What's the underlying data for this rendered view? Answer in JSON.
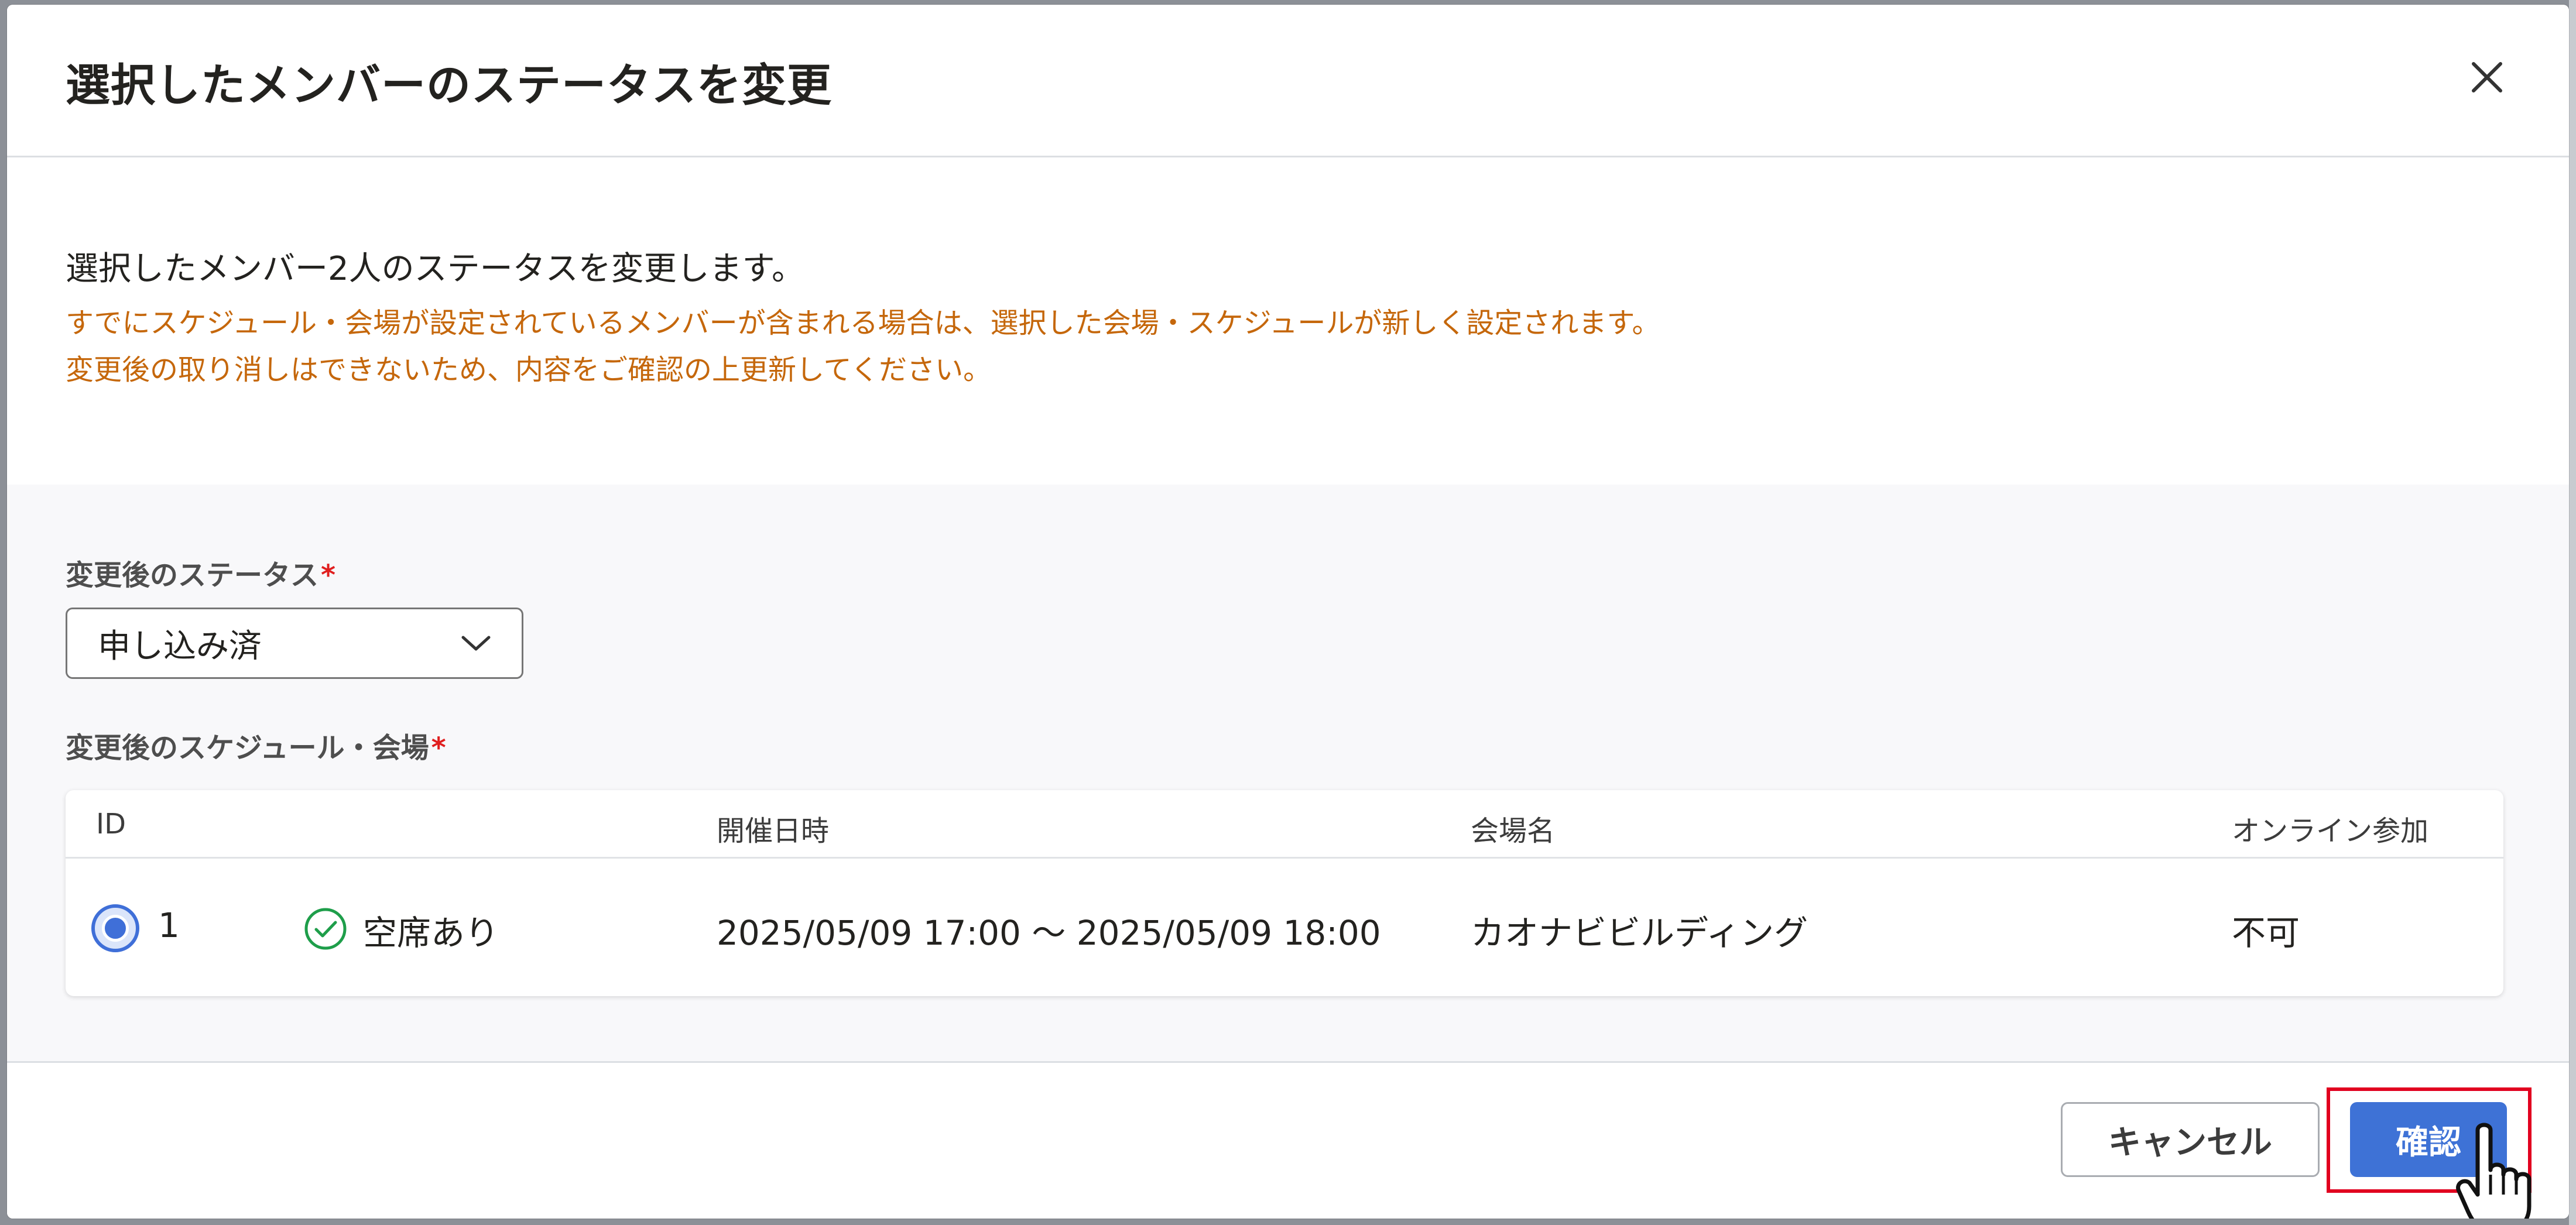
{
  "dialog": {
    "title": "選択したメンバーのステータスを変更",
    "close_label": "×"
  },
  "intro": {
    "main": "選択したメンバー2人のステータスを変更します。",
    "warning_line1": "すでにスケジュール・会場が設定されているメンバーが含まれる場合は、選択した会場・スケジュールが新しく設定されます。",
    "warning_line2": "変更後の取り消しはできないため、内容をご確認の上更新してください。"
  },
  "status_field": {
    "label": "変更後のステータス",
    "required_mark": "*",
    "selected_value": "申し込み済"
  },
  "schedule_field": {
    "label": "変更後のスケジュール・会場",
    "required_mark": "*",
    "columns": [
      "ID",
      "開催日時",
      "会場名",
      "オンライン参加"
    ],
    "rows": [
      {
        "selected": true,
        "id": "1",
        "availability": "空席あり",
        "datetime": "2025/05/09 17:00 〜 2025/05/09 18:00",
        "venue": "カオナビビルディング",
        "online": "不可"
      }
    ]
  },
  "footer": {
    "cancel_label": "キャンセル",
    "confirm_label": "確認"
  },
  "colors": {
    "warning_text": "#c5670b",
    "primary": "#3e72d6",
    "required": "#e01e1e",
    "available_icon": "#1e9e4a",
    "highlight": "#e1001f"
  },
  "icons": {
    "close": "close-icon",
    "dropdown": "chevron-down-icon",
    "availability": "check-circle-icon",
    "cursor": "hand-pointer-icon"
  }
}
